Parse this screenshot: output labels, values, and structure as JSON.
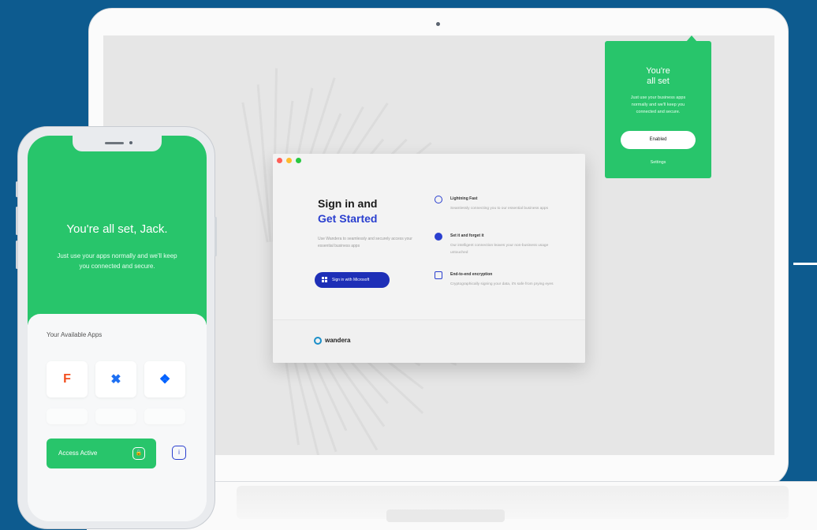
{
  "popup": {
    "title": "You're\nall set",
    "text": "Just use your business apps\nnormally and we'll keep you\nconnected and secure.",
    "button_label": "Enabled",
    "link_label": "Settings"
  },
  "window": {
    "heading_line1": "Sign in and",
    "heading_line2": "Get Started",
    "description": "Use Wandera to seamlessly and securely access your essential business apps",
    "signin_button_label": "Sign in with Microsoft",
    "features": [
      {
        "title": "Lightning Fast",
        "text": "Seamlessly connecting you to our essential business apps",
        "icon": "lightning-icon"
      },
      {
        "title": "Set it and forget it",
        "text": "Our intelligent connection leaves your non-business usage untouched",
        "icon": "globe-icon"
      },
      {
        "title": "End-to-end encryption",
        "text": "Cryptographically signing your data, it's safe from prying eyes",
        "icon": "id-card-icon"
      }
    ],
    "logo_text": "wandera"
  },
  "phone": {
    "title": "You're all set, Jack.",
    "text": "Just use your apps normally and we'll keep you connected and secure.",
    "apps_label": "Your Available Apps",
    "apps": [
      {
        "name": "figma-icon",
        "glyph": "F",
        "color": "#f24e1e"
      },
      {
        "name": "confluence-icon",
        "glyph": "✖",
        "color": "#1d6ff2"
      },
      {
        "name": "dropbox-icon",
        "glyph": "❖",
        "color": "#0061ff"
      }
    ],
    "access_label": "Access Active",
    "lock_glyph": "🔒",
    "info_glyph": "i"
  },
  "colors": {
    "background": "#0d5b8f",
    "accent_green": "#28c56b",
    "primary_blue": "#1e2fb7"
  }
}
